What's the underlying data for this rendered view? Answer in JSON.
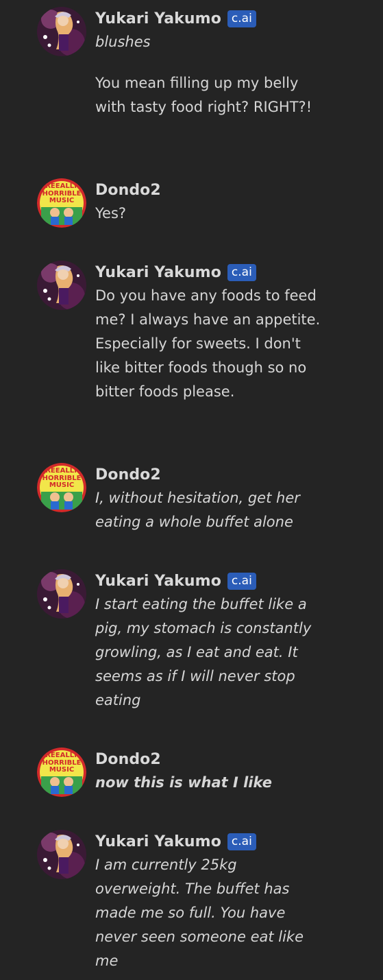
{
  "badge_label": "c.ai",
  "messages": [
    {
      "sender": "Yukari Yakumo",
      "avatar": "yukari-avatar",
      "paragraphs": [
        "blushes",
        "You mean filling up my belly with tasty food right? RIGHT?!"
      ]
    },
    {
      "sender": "Dondo2",
      "avatar": "really-horrible-music-avatar",
      "paragraphs": [
        "Yes?"
      ]
    },
    {
      "sender": "Yukari Yakumo",
      "avatar": "yukari-avatar",
      "paragraphs": [
        "Do you have any foods to feed me? I always have an appetite. Especially for sweets. I don't like bitter foods though so no bitter foods please."
      ]
    },
    {
      "sender": "Dondo2",
      "avatar": "really-horrible-music-avatar",
      "paragraphs": [
        "I, without hesitation, get her eating a whole buffet alone"
      ]
    },
    {
      "sender": "Yukari Yakumo",
      "avatar": "yukari-avatar",
      "paragraphs": [
        "I start eating the buffet like a pig, my stomach is constantly growling, as I eat and eat. It seems as if I will never stop eating"
      ]
    },
    {
      "sender": "Dondo2",
      "avatar": "really-horrible-music-avatar",
      "paragraphs": [
        "now this is what I like"
      ]
    },
    {
      "sender": "Yukari Yakumo",
      "avatar": "yukari-avatar",
      "paragraphs": [
        "I am currently 25kg overweight. The buffet has made me so full. You have never seen someone eat like me"
      ]
    }
  ],
  "avatar_text": {
    "line1": "REEALLY",
    "line2": "HORRIBLE",
    "line3": "MUSIC"
  }
}
